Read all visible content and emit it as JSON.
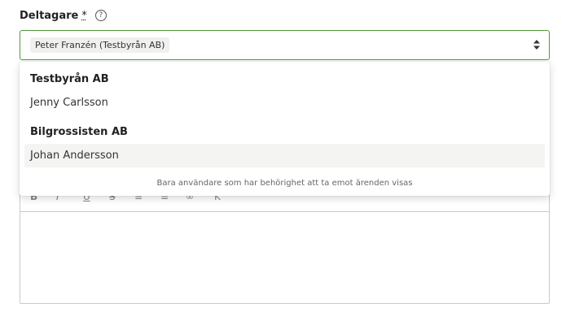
{
  "field": {
    "label": "Deltagare",
    "required_mark": "*",
    "help_icon": "question-circle-icon"
  },
  "select": {
    "selected_chip": "Peter Franzén (Testbyrån AB)",
    "sort_icon": "sort-up-down-icon",
    "border_color": "#4f9a3a"
  },
  "dropdown": {
    "groups": [
      {
        "header": "Testbyrån AB",
        "options": [
          "Jenny Carlsson"
        ]
      },
      {
        "header": "Bilgrossisten AB",
        "options": [
          "Johan Andersson"
        ]
      }
    ],
    "footer_note": "Bara användare som har behörighet att ta emot ärenden visas"
  },
  "editor": {
    "toolbar_icons": [
      "bold-icon",
      "italic-icon",
      "underline-icon",
      "strikethrough-icon",
      "ordered-list-icon",
      "bullet-list-icon",
      "link-icon",
      "clear-format-icon"
    ],
    "toolbar_glyphs": [
      "B",
      "I",
      "U",
      "S",
      "≡",
      "≡",
      "∞",
      "K"
    ]
  }
}
